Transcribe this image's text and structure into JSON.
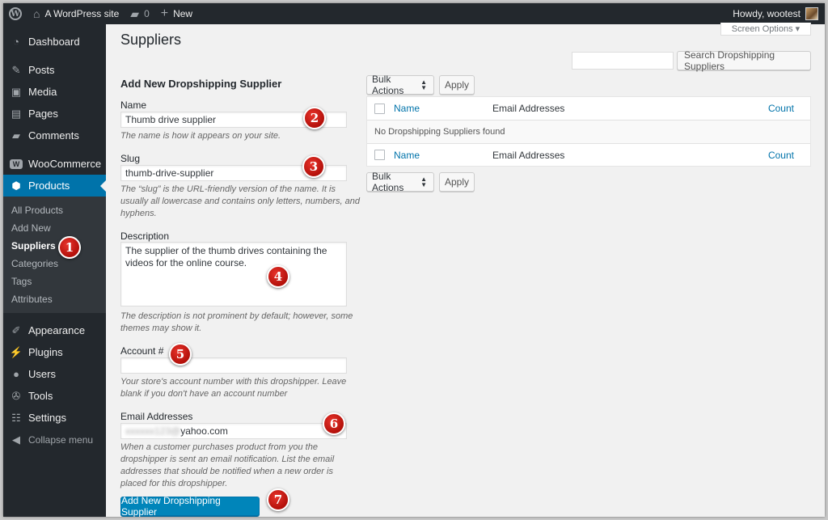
{
  "adminbar": {
    "site_name": "A WordPress site",
    "comments_count": "0",
    "new_label": "New",
    "howdy": "Howdy, wootest"
  },
  "sidebar": {
    "items": [
      {
        "label": "Dashboard",
        "icon": "dashboard-icon"
      },
      {
        "label": "Posts",
        "icon": "pin-icon"
      },
      {
        "label": "Media",
        "icon": "media-icon"
      },
      {
        "label": "Pages",
        "icon": "pages-icon"
      },
      {
        "label": "Comments",
        "icon": "comment-icon"
      },
      {
        "label": "WooCommerce",
        "icon": "woo-icon"
      },
      {
        "label": "Products",
        "icon": "box-icon"
      },
      {
        "label": "Appearance",
        "icon": "brush-icon"
      },
      {
        "label": "Plugins",
        "icon": "plug-icon"
      },
      {
        "label": "Users",
        "icon": "user-icon"
      },
      {
        "label": "Tools",
        "icon": "wrench-icon"
      },
      {
        "label": "Settings",
        "icon": "sliders-icon"
      }
    ],
    "submenu": [
      "All Products",
      "Add New",
      "Suppliers",
      "Categories",
      "Tags",
      "Attributes"
    ],
    "collapse_label": "Collapse menu"
  },
  "page": {
    "title": "Suppliers",
    "screen_options": "Screen Options ▾",
    "search_button": "Search Dropshipping Suppliers"
  },
  "form": {
    "heading": "Add New Dropshipping Supplier",
    "name_label": "Name",
    "name_value": "Thumb drive supplier",
    "name_hint": "The name is how it appears on your site.",
    "slug_label": "Slug",
    "slug_value": "thumb-drive-supplier",
    "slug_hint": "The “slug” is the URL-friendly version of the name. It is usually all lowercase and contains only letters, numbers, and hyphens.",
    "description_label": "Description",
    "description_value": "The supplier of the thumb drives containing the videos for the online course.",
    "description_hint": "The description is not prominent by default; however, some themes may show it.",
    "account_label": "Account #",
    "account_hint": "Your store's account number with this dropshipper. Leave blank if you don't have an account number",
    "email_label": "Email Addresses",
    "email_blurred": "xxxxxx123@",
    "email_value": "yahoo.com",
    "email_hint": "When a customer purchases product from you the dropshipper is sent an email notification. List the email addresses that should be notified when a new order is placed for this dropshipper.",
    "submit_label": "Add New Dropshipping Supplier"
  },
  "table": {
    "bulk_actions": "Bulk Actions",
    "apply": "Apply",
    "columns": [
      "Name",
      "Email Addresses",
      "Count"
    ],
    "empty_message": "No Dropshipping Suppliers found"
  },
  "markers": [
    "1",
    "2",
    "3",
    "4",
    "5",
    "6",
    "7"
  ],
  "colors": {
    "adminbar_bg": "#23282d",
    "active_menu": "#0073aa",
    "primary_button": "#0085ba",
    "marker": "#d0211a"
  }
}
